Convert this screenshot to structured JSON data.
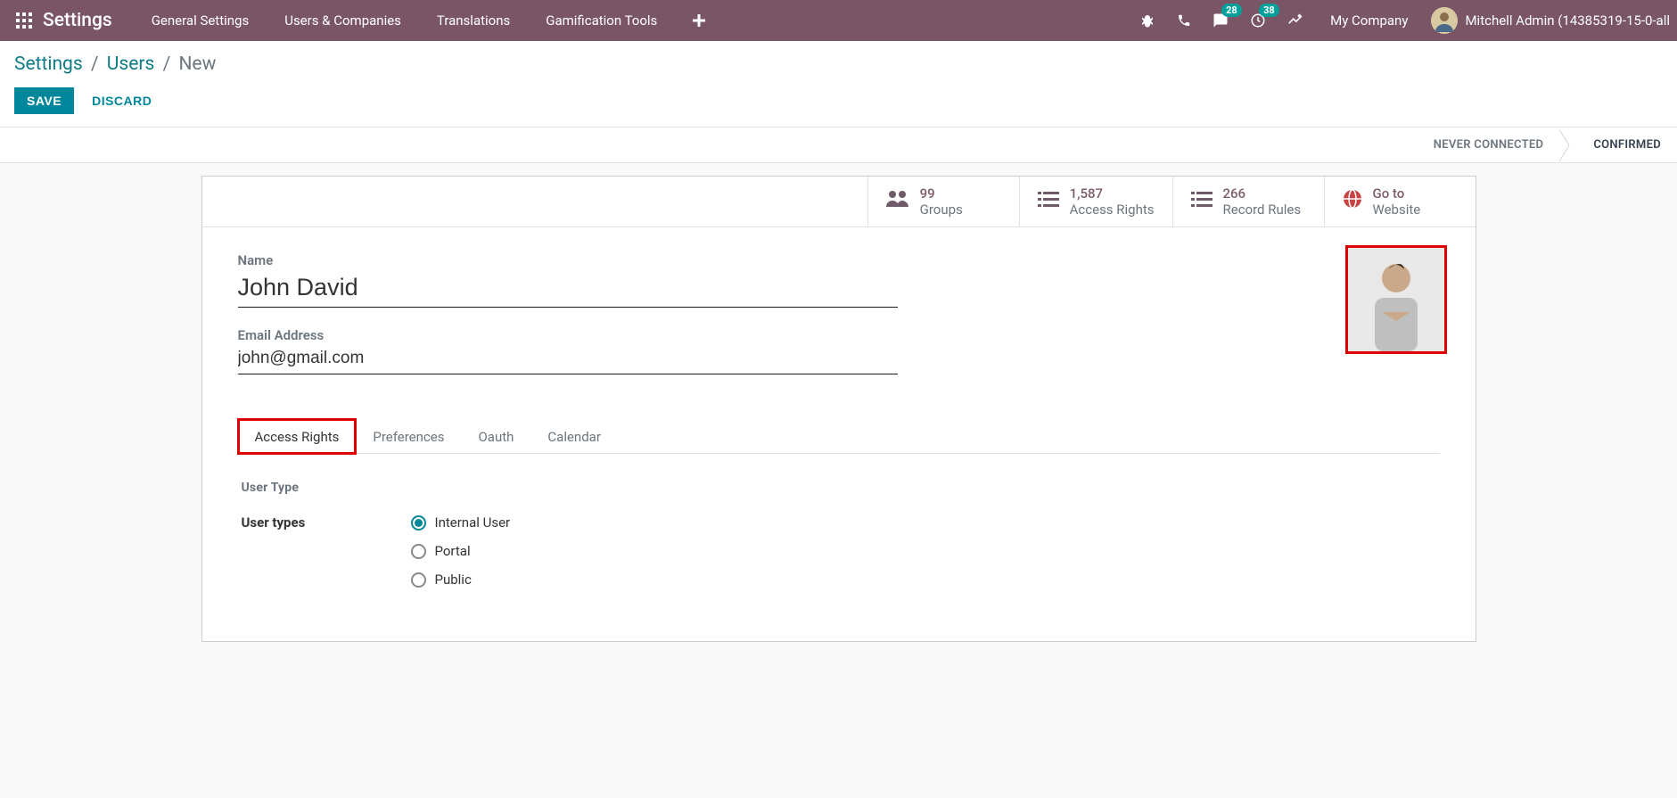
{
  "navbar": {
    "app_title": "Settings",
    "items": [
      "General Settings",
      "Users & Companies",
      "Translations",
      "Gamification Tools"
    ],
    "company": "My Company",
    "user": "Mitchell Admin (14385319-15-0-all",
    "badge_messages": "28",
    "badge_activities": "38"
  },
  "breadcrumbs": {
    "a": "Settings",
    "b": "Users",
    "current": "New"
  },
  "buttons": {
    "save": "SAVE",
    "discard": "DISCARD"
  },
  "status": {
    "s1": "NEVER CONNECTED",
    "s2": "CONFIRMED"
  },
  "stats": [
    {
      "num": "99",
      "lbl": "Groups",
      "icon": "users"
    },
    {
      "num": "1,587",
      "lbl": "Access Rights",
      "icon": "list"
    },
    {
      "num": "266",
      "lbl": "Record Rules",
      "icon": "list"
    },
    {
      "num": "Go to",
      "lbl": "Website",
      "icon": "globe"
    }
  ],
  "form": {
    "name_label": "Name",
    "name_value": "John David",
    "email_label": "Email Address",
    "email_value": "john@gmail.com"
  },
  "tabs": [
    "Access Rights",
    "Preferences",
    "Oauth",
    "Calendar"
  ],
  "usertype": {
    "section": "User Type",
    "label": "User types",
    "opts": [
      "Internal User",
      "Portal",
      "Public"
    ]
  }
}
